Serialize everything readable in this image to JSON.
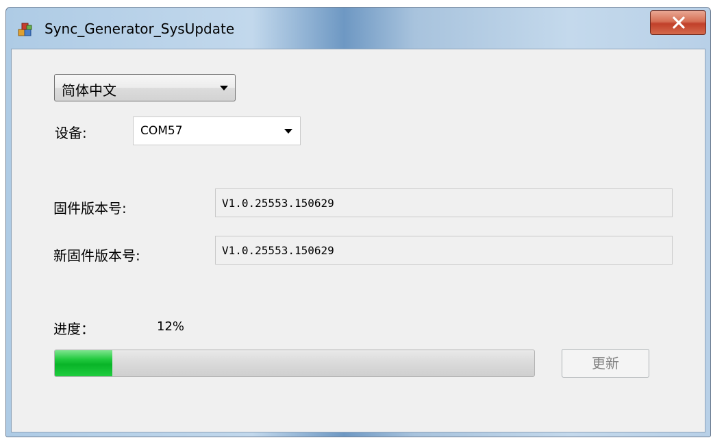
{
  "window": {
    "title": "Sync_Generator_SysUpdate"
  },
  "language": {
    "selected": "简体中文"
  },
  "device": {
    "label": "设备:",
    "selected": "COM57"
  },
  "firmware": {
    "label": "固件版本号:",
    "value": "V1.0.25553.150629"
  },
  "new_firmware": {
    "label": "新固件版本号:",
    "value": "V1.0.25553.150629"
  },
  "progress": {
    "label": "进度：",
    "percent_text": "12%",
    "fraction": 0.12
  },
  "update_button": {
    "label": "更新",
    "enabled": false
  },
  "colors": {
    "progress_green": "#21c93e",
    "close_red": "#c1402a"
  },
  "icons": {
    "app": "app-blocks-icon",
    "close": "close-icon",
    "dropdown": "chevron-down-icon"
  }
}
